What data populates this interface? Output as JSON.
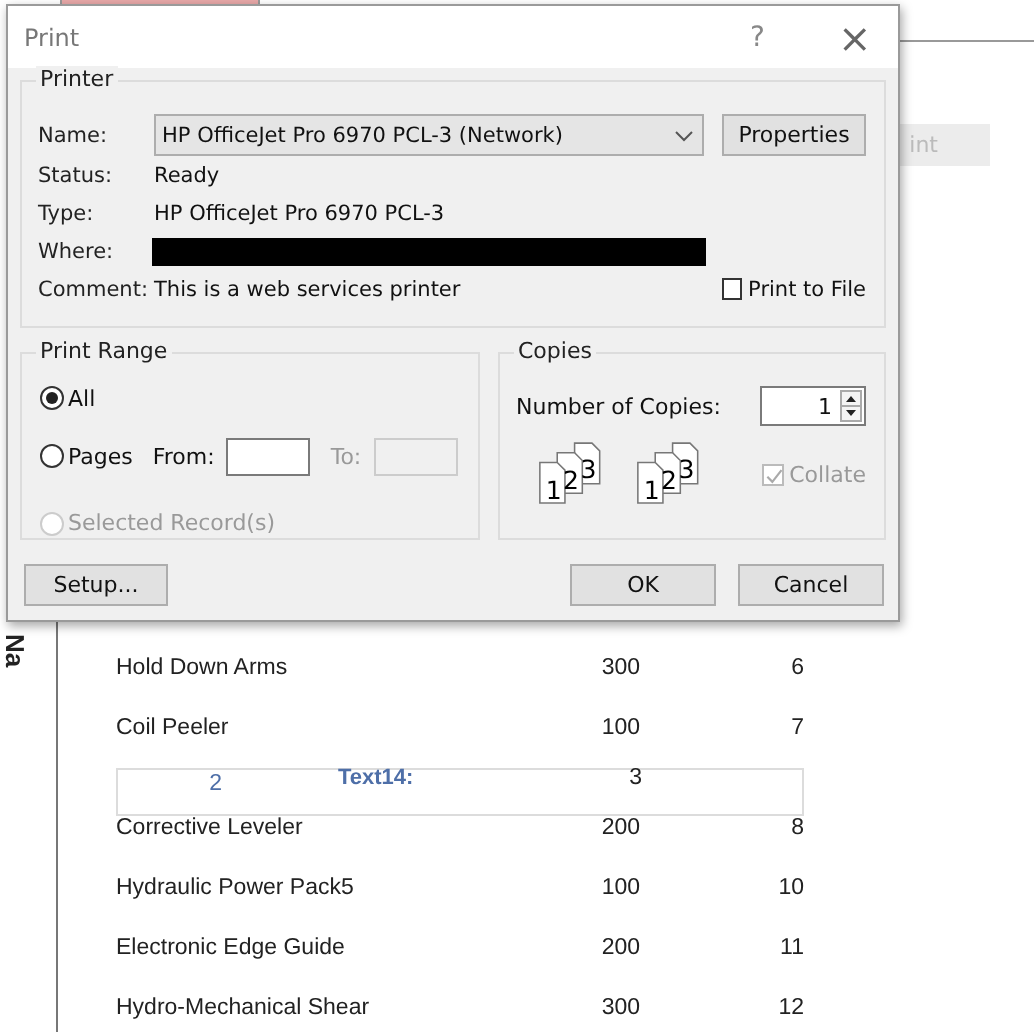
{
  "document_tab": {
    "selected": true
  },
  "toolbar_button": {
    "label": "int"
  },
  "nav_pane": {
    "label": "Na"
  },
  "report": {
    "rows": [
      {
        "kind": "detail",
        "name": "Hold Down Arms",
        "quantity": "300",
        "id": "6"
      },
      {
        "kind": "detail",
        "name": "Coil Peeler",
        "quantity": "100",
        "id": "7"
      },
      {
        "kind": "group",
        "number": "2",
        "label": "Text14:",
        "value": "3"
      },
      {
        "kind": "detail",
        "name": "Corrective Leveler",
        "quantity": "200",
        "id": "8"
      },
      {
        "kind": "detail",
        "name": "Hydraulic Power Pack5",
        "quantity": "100",
        "id": "10"
      },
      {
        "kind": "detail",
        "name": "Electronic Edge Guide",
        "quantity": "200",
        "id": "11"
      },
      {
        "kind": "detail",
        "name": "Hydro-Mechanical Shear",
        "quantity": "300",
        "id": "12"
      }
    ]
  },
  "dialog": {
    "title": "Print",
    "help": "?",
    "close": "×",
    "printer": {
      "legend": "Printer",
      "name_label": "Name:",
      "name_value": "HP OfficeJet Pro 6970 PCL-3 (Network)",
      "properties": "Properties",
      "status_label": "Status:",
      "status": "Ready",
      "type_label": "Type:",
      "type": "HP OfficeJet Pro 6970 PCL-3",
      "where_label": "Where:",
      "where_redacted": true,
      "comment_label": "Comment:",
      "comment": "This is a web services printer",
      "print_to_file": {
        "label": "Print to File",
        "checked": false
      }
    },
    "print_range": {
      "legend": "Print Range",
      "options": [
        {
          "kind": "plain",
          "label": "All",
          "selected": true,
          "disabled": false
        },
        {
          "kind": "pages",
          "label": "Pages",
          "selected": false,
          "disabled": false,
          "from_label": "From:",
          "to_label": "To:"
        },
        {
          "kind": "plain",
          "label": "Selected Record(s)",
          "selected": false,
          "disabled": true
        }
      ]
    },
    "copies": {
      "legend": "Copies",
      "count_label": "Number of Copies:",
      "count": "1",
      "page_stacks": [
        [
          "1",
          "2",
          "3"
        ],
        [
          "1",
          "2",
          "3"
        ]
      ],
      "collate": {
        "label": "Collate",
        "checked": true,
        "disabled": true
      }
    },
    "buttons": {
      "setup": "Setup...",
      "ok": "OK",
      "cancel": "Cancel"
    }
  }
}
